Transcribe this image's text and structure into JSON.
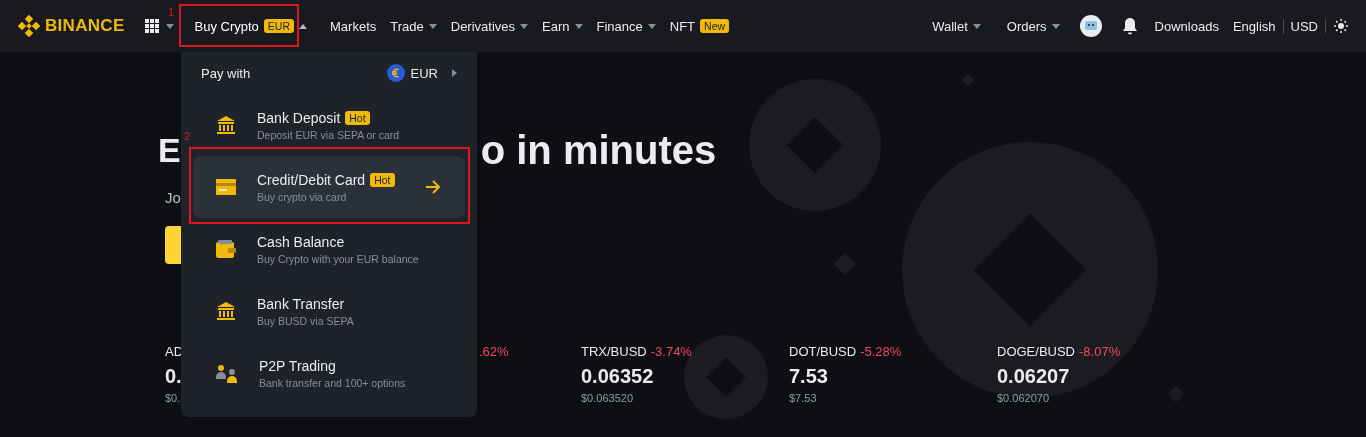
{
  "nav": {
    "logo": "BINANCE",
    "items": [
      {
        "label": "Buy Crypto",
        "badge": "EUR",
        "dropdown": true,
        "expanded": true
      },
      {
        "label": "Markets",
        "dropdown": false,
        "expanded": false
      },
      {
        "label": "Trade",
        "dropdown": true,
        "expanded": false
      },
      {
        "label": "Derivatives",
        "dropdown": true,
        "expanded": false
      },
      {
        "label": "Earn",
        "dropdown": true,
        "expanded": false
      },
      {
        "label": "Finance",
        "dropdown": true,
        "expanded": false
      },
      {
        "label": "NFT",
        "badge": "New",
        "dropdown": false,
        "expanded": false
      }
    ],
    "right": [
      {
        "label": "Wallet",
        "kind": "menu"
      },
      {
        "label": "Orders",
        "kind": "menu"
      },
      {
        "kind": "avatar"
      },
      {
        "kind": "bell"
      },
      {
        "label": "Downloads",
        "kind": "link"
      },
      {
        "label": "English",
        "kind": "link"
      },
      {
        "label": "USD",
        "kind": "link"
      },
      {
        "kind": "theme"
      }
    ]
  },
  "hero": {
    "title_left": "E",
    "title_right": "o in minutes",
    "subtitle": "Jo"
  },
  "tickers": [
    {
      "pair": "AD",
      "price": "0.",
      "usd": "$0."
    },
    {
      "change": ".62%"
    },
    {
      "pair": "TRX/BUSD",
      "change": "-3.74%",
      "price": "0.06352",
      "usd": "$0.063520"
    },
    {
      "pair": "DOT/BUSD",
      "change": "-5.28%",
      "price": "7.53",
      "usd": "$7.53"
    },
    {
      "pair": "DOGE/BUSD",
      "change": "-8.07%",
      "price": "0.06207",
      "usd": "$0.062070"
    }
  ],
  "menu": {
    "header": "Pay with",
    "currency": "EUR",
    "items": [
      {
        "kind": "bank",
        "title": "Bank Deposit",
        "badge": "Hot",
        "subtitle": "Deposit EUR via SEPA or card",
        "selected": false
      },
      {
        "kind": "card",
        "title": "Credit/Debit Card",
        "badge": "Hot",
        "subtitle": "Buy crypto via card",
        "selected": true
      },
      {
        "kind": "wallet",
        "title": "Cash Balance",
        "subtitle": "Buy Crypto with your EUR balance",
        "selected": false
      },
      {
        "kind": "bank",
        "title": "Bank Transfer",
        "subtitle": "Buy BUSD via SEPA",
        "selected": false
      },
      {
        "kind": "p2p",
        "title": "P2P Trading",
        "subtitle": "Bank transfer and 100+ options",
        "selected": false
      }
    ]
  },
  "annotations": [
    {
      "label": "1"
    },
    {
      "label": "2"
    }
  ]
}
